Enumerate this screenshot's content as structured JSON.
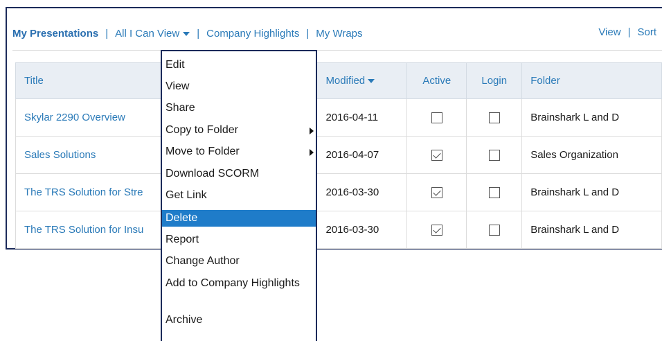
{
  "nav": {
    "my_presentations": "My Presentations",
    "all_i_can_view": "All I Can View",
    "company_highlights": "Company Highlights",
    "my_wraps": "My Wraps",
    "separator": "|",
    "view": "View",
    "sort": "Sort"
  },
  "table": {
    "headers": {
      "title": "Title",
      "modified": "Modified",
      "active": "Active",
      "login": "Login",
      "folder": "Folder"
    },
    "rows": [
      {
        "title": "Skylar 2290 Overview",
        "modified": "2016-04-11",
        "active": false,
        "login": false,
        "folder": "Brainshark L and D"
      },
      {
        "title": "Sales Solutions",
        "modified": "2016-04-07",
        "active": true,
        "login": false,
        "folder": "Sales Organization"
      },
      {
        "title": "The TRS Solution for Stre",
        "modified": "2016-03-30",
        "active": true,
        "login": false,
        "folder": "Brainshark L and D"
      },
      {
        "title": "The TRS Solution for Insu",
        "modified": "2016-03-30",
        "active": true,
        "login": false,
        "folder": "Brainshark L and D"
      }
    ]
  },
  "context_menu": {
    "items": [
      {
        "label": "Edit"
      },
      {
        "label": "View"
      },
      {
        "label": "Share"
      },
      {
        "label": "Copy to Folder",
        "submenu": true
      },
      {
        "label": "Move to Folder",
        "submenu": true
      },
      {
        "label": "Download SCORM"
      },
      {
        "label": "Get Link"
      },
      {
        "label": "Delete",
        "selected": true
      },
      {
        "label": "Report"
      },
      {
        "label": "Change Author"
      },
      {
        "label": "Add to Company Highlights"
      },
      {
        "label": "Archive"
      }
    ]
  },
  "colors": {
    "link": "#2a7ab8",
    "menu_selected": "#1f7cc9",
    "border_dark": "#1b2a5a",
    "header_bg": "#e9eef4"
  }
}
